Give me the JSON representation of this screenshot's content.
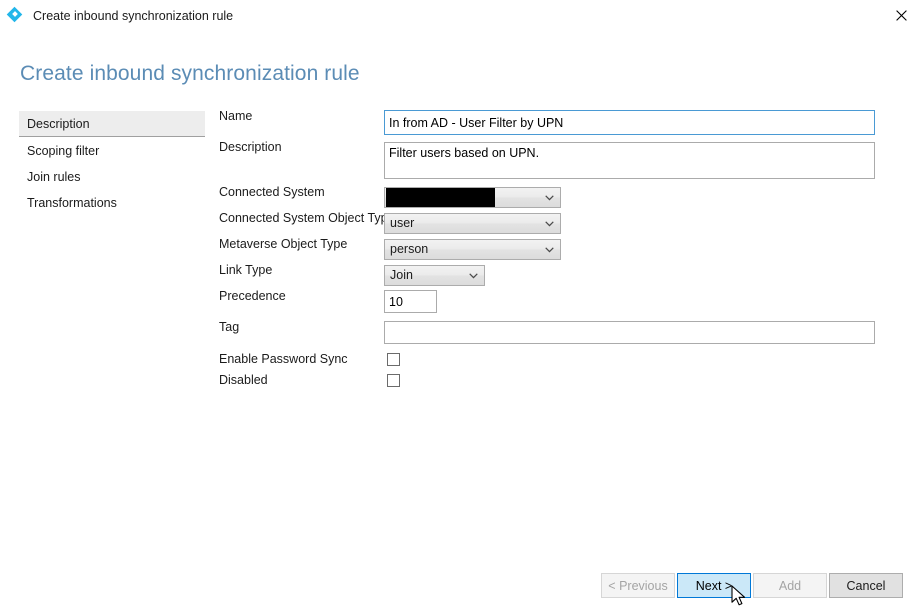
{
  "window": {
    "title": "Create inbound synchronization rule",
    "icon": "azure-ad-connect-diamond-icon",
    "close_label": "close-icon"
  },
  "page": {
    "heading": "Create inbound synchronization rule",
    "heading_color": "#5b8cb5"
  },
  "sidebar": {
    "items": [
      {
        "label": "Description",
        "selected": true
      },
      {
        "label": "Scoping filter",
        "selected": false
      },
      {
        "label": "Join rules",
        "selected": false
      },
      {
        "label": "Transformations",
        "selected": false
      }
    ]
  },
  "form": {
    "name": {
      "label": "Name",
      "value": "In from AD - User Filter by UPN",
      "focused": true
    },
    "description": {
      "label": "Description",
      "value": "Filter users based on UPN."
    },
    "connected_system": {
      "label": "Connected System",
      "value": "",
      "redacted": true
    },
    "connected_system_object_type": {
      "label": "Connected System Object Type",
      "value": "user"
    },
    "metaverse_object_type": {
      "label": "Metaverse Object Type",
      "value": "person"
    },
    "link_type": {
      "label": "Link Type",
      "value": "Join"
    },
    "precedence": {
      "label": "Precedence",
      "value": "10"
    },
    "tag": {
      "label": "Tag",
      "value": ""
    },
    "enable_password_sync": {
      "label": "Enable Password Sync",
      "checked": false
    },
    "disabled_flag": {
      "label": "Disabled",
      "checked": false
    }
  },
  "footer": {
    "previous": {
      "label": "< Previous",
      "enabled": false
    },
    "next": {
      "label": "Next >",
      "enabled": true,
      "hovered": true
    },
    "add": {
      "label": "Add",
      "enabled": false
    },
    "cancel": {
      "label": "Cancel",
      "enabled": true
    }
  },
  "colors": {
    "accent": "#0078d7",
    "hover_fill": "#cbe8f8",
    "heading": "#5b8cb5",
    "icon": "#22b6ea"
  }
}
